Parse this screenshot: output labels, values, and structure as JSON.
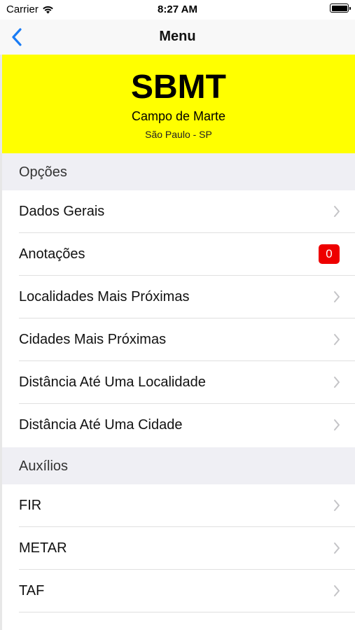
{
  "status_bar": {
    "carrier": "Carrier",
    "time": "8:27 AM"
  },
  "nav": {
    "title": "Menu"
  },
  "station": {
    "code": "SBMT",
    "name": "Campo de Marte",
    "city": "São Paulo - SP"
  },
  "sections": {
    "options": {
      "title": "Opções",
      "items": [
        {
          "label": "Dados Gerais"
        },
        {
          "label": "Anotações",
          "badge": "0"
        },
        {
          "label": "Localidades Mais Próximas"
        },
        {
          "label": "Cidades Mais Próximas"
        },
        {
          "label": "Distância Até Uma Localidade"
        },
        {
          "label": "Distância Até Uma Cidade"
        }
      ]
    },
    "aids": {
      "title": "Auxílios",
      "items": [
        {
          "label": "FIR"
        },
        {
          "label": "METAR"
        },
        {
          "label": "TAF"
        }
      ]
    }
  },
  "colors": {
    "header_bg": "#ffff00",
    "accent": "#1a7cf5",
    "badge": "#ee0000"
  }
}
